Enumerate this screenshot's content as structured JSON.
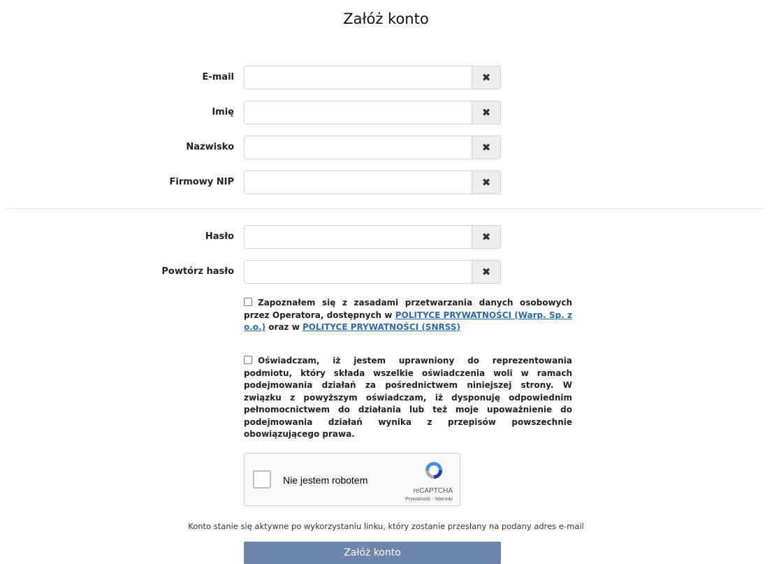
{
  "page_title": "Załóż konto",
  "fields": [
    {
      "label": "E-mail",
      "value": "",
      "clear_icon": "close-icon"
    },
    {
      "label": "Imię",
      "value": "",
      "clear_icon": "close-icon"
    },
    {
      "label": "Nazwisko",
      "value": "",
      "clear_icon": "close-icon"
    },
    {
      "label": "Firmowy NIP",
      "value": "",
      "clear_icon": "close-icon"
    },
    {
      "label": "Hasło",
      "value": "",
      "clear_icon": "close-icon"
    },
    {
      "label": "Powtórz hasło",
      "value": "",
      "clear_icon": "close-icon"
    }
  ],
  "consent_privacy": {
    "text_before": "Zapoznałem się z zasadami przetwarzania danych osobowych przez Operatora, dostępnych w",
    "link1": "POLITYCE PRYWATNOŚCI (Warp. Sp. z o.o.)",
    "text_middle": "oraz w",
    "link2": "POLITYCE PRYWATNOŚCI (SNRSS)",
    "checked": false
  },
  "consent_authority": {
    "text": "Oświadczam, iż jestem uprawniony do reprezentowania podmiotu, który składa wszelkie oświadczenia woli w ramach podejmowania działań za pośrednictwem niniejszej strony. W związku z powyższym oświadczam, iż dysponuję odpowiednim pełnomocnictwem do działania lub też moje upoważnienie do podejmowania działań wynika z przepisów powszechnie obowiązującego prawa.",
    "checked": false
  },
  "recaptcha": {
    "label": "Nie jestem robotem",
    "brand": "reCAPTCHA",
    "privacy": "Prywatność",
    "separator": " - ",
    "terms": "Warunki"
  },
  "info_text": "Konto stanie się aktywne po wykorzystaniu linku, który zostanie przesłany na podany adres e-mail",
  "submit_label": "Załóż konto",
  "colors": {
    "submit": "#6e86ab",
    "link": "#2a6ab0"
  }
}
